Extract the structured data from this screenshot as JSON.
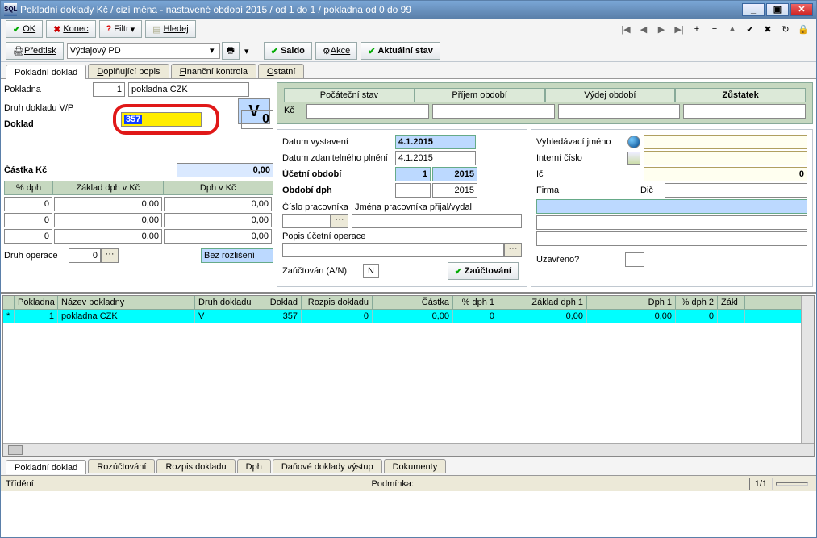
{
  "window": {
    "title": "Pokladní doklady Kč / cizí měna - nastavené období 2015 / od 1 do 1 / pokladna od 0 do 99"
  },
  "toolbar1": {
    "ok": "OK",
    "konec": "Konec",
    "filtr": "Filtr",
    "hledej": "Hledej"
  },
  "toolbar2": {
    "predtisk": "Předtisk",
    "type": "Výdajový PD",
    "saldo": "Saldo",
    "akce": "Akce",
    "aktualni": "Aktuální stav"
  },
  "navsym": [
    "|◀",
    "◀",
    "▶",
    "▶|",
    "+",
    "−",
    "▲",
    "✔",
    "✖",
    "↻",
    "🔒"
  ],
  "tabs": {
    "main": [
      "Pokladní doklad",
      "Doplňující popis",
      "Finanční kontrola",
      "Ostatní"
    ],
    "active": 0
  },
  "left": {
    "pokladna_lbl": "Pokladna",
    "pokladna_num": "1",
    "pokladna_name": "pokladna CZK",
    "druh_lbl": "Druh dokladu V/P",
    "druh_v": "V",
    "druh_0": "0",
    "doklad_lbl": "Doklad",
    "doklad_val": "357",
    "castka_lbl": "Částka Kč",
    "castka_val": "0,00",
    "dph_hdr": [
      "% dph",
      "Základ dph v Kč",
      "Dph v Kč"
    ],
    "dph_rows": [
      [
        "0",
        "0,00",
        "0,00"
      ],
      [
        "0",
        "0,00",
        "0,00"
      ],
      [
        "0",
        "0,00",
        "0,00"
      ]
    ],
    "druh_op_lbl": "Druh operace",
    "druh_op_val": "0",
    "druh_op_sel": "Bez rozlišení"
  },
  "green": {
    "headers": [
      "Počáteční stav",
      "Příjem období",
      "Výdej období",
      "Zůstatek"
    ],
    "kc": "Kč"
  },
  "mid": {
    "dat_vyst_lbl": "Datum vystavení",
    "dat_vyst": "4.1.2015",
    "dat_zdan_lbl": "Datum zdanitelného plnění",
    "dat_zdan": "4.1.2015",
    "uc_ob_lbl": "Účetní období",
    "uc_ob_m": "1",
    "uc_ob_y": "2015",
    "ob_dph_lbl": "Období dph",
    "ob_dph_y": "2015",
    "cislo_prac_lbl": "Číslo pracovníka",
    "jmena_lbl": "Jména pracovníka přijal/vydal",
    "popis_lbl": "Popis účetní operace",
    "zauc_lbl": "Zaúčtován (A/N)",
    "zauc_val": "N",
    "zauc_btn": "Zaúčtování"
  },
  "side": {
    "vyh_lbl": "Vyhledávací jméno",
    "int_lbl": "Interní číslo",
    "ic_lbl": "Ič",
    "ic_val": "0",
    "firma_lbl": "Firma",
    "dic_lbl": "Dič",
    "uzav_lbl": "Uzavřeno?"
  },
  "grid": {
    "headers": [
      "Pokladna",
      "Název pokladny",
      "Druh dokladu",
      "Doklad",
      "Rozpis dokladu",
      "Částka",
      "% dph 1",
      "Základ dph 1",
      "Dph 1",
      "% dph 2",
      "Zákl"
    ],
    "row": [
      "1",
      "pokladna CZK",
      "V",
      "357",
      "0",
      "0,00",
      "0",
      "0,00",
      "0,00",
      "0",
      ""
    ]
  },
  "btabs": [
    "Pokladní doklad",
    "Rozúčtování",
    "Rozpis dokladu",
    "Dph",
    "Daňové doklady výstup",
    "Dokumenty"
  ],
  "status": {
    "trideni": "Třídění:",
    "podminka": "Podmínka:",
    "page": "1/1"
  }
}
